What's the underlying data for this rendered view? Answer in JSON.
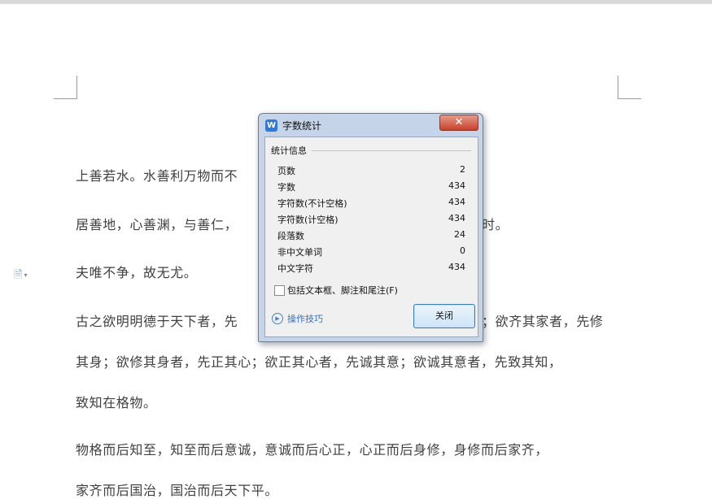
{
  "document": {
    "lines": [
      "上善若水。水善利万物而不",
      "居善地，心善渊，与善仁，",
      "夫唯不争，故无尤。",
      "古之欲明明德于天下者，先",
      "其身；欲修其身者，先正其心；欲正其心者，先诚其意；欲诚其意者，先致其知，",
      "致知在格物。",
      "物格而后知至，知至而后意诚，意诚而后心正，心正而后身修，身修而后家齐，",
      "家齐而后国治，国治而后天下平。"
    ],
    "line_fragments": {
      "line2_tail": "时。",
      "line4_tail": "；欲齐其家者，先修"
    }
  },
  "dialog": {
    "title": "字数统计",
    "close_glyph": "✕",
    "group_title": "统计信息",
    "stats": [
      {
        "label": "页数",
        "value": "2"
      },
      {
        "label": "字数",
        "value": "434"
      },
      {
        "label": "字符数(不计空格)",
        "value": "434"
      },
      {
        "label": "字符数(计空格)",
        "value": "434"
      },
      {
        "label": "段落数",
        "value": "24"
      },
      {
        "label": "非中文单词",
        "value": "0"
      },
      {
        "label": "中文字符",
        "value": "434"
      }
    ],
    "include_checkbox_label": "包括文本框、脚注和尾注(F)",
    "include_checked": false,
    "tips_label": "操作技巧",
    "close_button_label": "关闭"
  },
  "icons": {
    "app_icon": "wps-writer-icon",
    "app_icon_glyph": "W",
    "paragraph_icon": "document-icon",
    "paragraph_glyph": "🗎",
    "paragraph_caret": "▾",
    "tips_icon": "play-circle-icon",
    "tips_glyph": "▶"
  },
  "colors": {
    "dialog_frame": "#c5d4e8",
    "accent_blue": "#2f7ad6",
    "close_red": "#c7412b",
    "link_blue": "#3b6fb5",
    "body_text": "#404040"
  }
}
